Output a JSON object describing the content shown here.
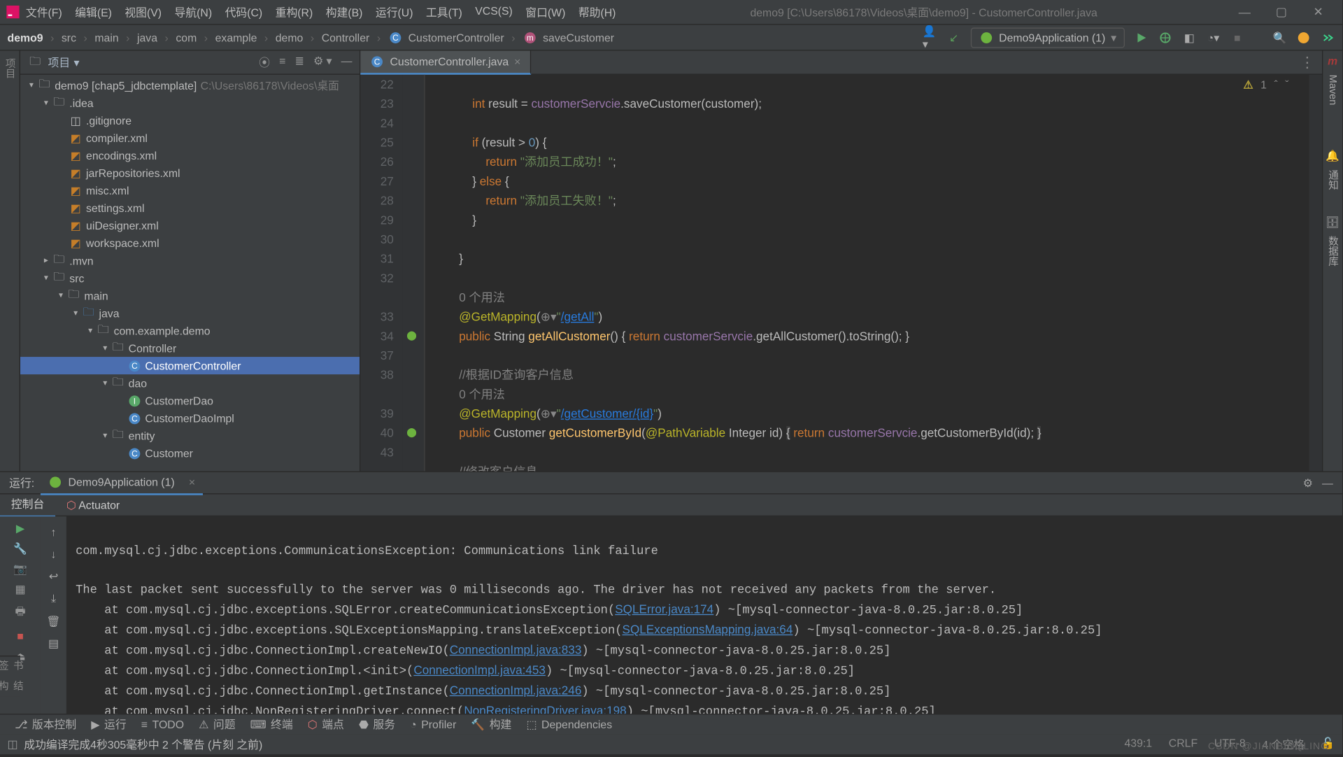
{
  "menubar": [
    "文件(F)",
    "编辑(E)",
    "视图(V)",
    "导航(N)",
    "代码(C)",
    "重构(R)",
    "构建(B)",
    "运行(U)",
    "工具(T)",
    "VCS(S)",
    "窗口(W)",
    "帮助(H)"
  ],
  "window_title": "demo9 [C:\\Users\\86178\\Videos\\桌面\\demo9] - CustomerController.java",
  "breadcrumb": [
    "demo9",
    "src",
    "main",
    "java",
    "com",
    "example",
    "demo",
    "Controller",
    "CustomerController",
    "saveCustomer"
  ],
  "run_config": "Demo9Application (1)",
  "project": {
    "header": "项目",
    "root": "demo9 [chap5_jdbctemplate]",
    "root_path": " C:\\Users\\86178\\Videos\\桌面",
    "idea": ".idea",
    "idea_children": [
      ".gitignore",
      "compiler.xml",
      "encodings.xml",
      "jarRepositories.xml",
      "misc.xml",
      "settings.xml",
      "uiDesigner.xml",
      "workspace.xml"
    ],
    "mvn": ".mvn",
    "src": "src",
    "main": "main",
    "java": "java",
    "pkg": "com.example.demo",
    "controller_folder": "Controller",
    "controller_class": "CustomerController",
    "dao_folder": "dao",
    "dao1": "CustomerDao",
    "dao2": "CustomerDaoImpl",
    "entity_folder": "entity",
    "entity1": "Customer"
  },
  "editor": {
    "tab": "CustomerController.java",
    "warnings": "1",
    "lines": [
      "22",
      "23",
      "24",
      "25",
      "26",
      "27",
      "28",
      "29",
      "30",
      "31",
      "32",
      "",
      "33",
      "34",
      "37",
      "38",
      "",
      "39",
      "40",
      "43",
      ""
    ],
    "usage_hint": "0 个用法"
  },
  "run": {
    "title": "运行:",
    "tab": "Demo9Application (1)",
    "subtabs": [
      "控制台",
      "Actuator"
    ]
  },
  "statusbar": {
    "items": [
      "版本控制",
      "运行",
      "TODO",
      "问题",
      "终端",
      "端点",
      "服务",
      "Profiler",
      "构建",
      "Dependencies"
    ],
    "msg": "成功编译完成4秒305毫秒中 2 个警告 (片刻 之前)",
    "right": [
      "439:1",
      "CRLF",
      "UTF-8",
      "4 个空格"
    ]
  },
  "watermark": "CSDN @JIANBINQLING",
  "leftstrip": [
    "项目",
    "结构",
    "书签"
  ],
  "rightstrip": [
    "m",
    "Maven",
    "通知",
    "数据库"
  ]
}
